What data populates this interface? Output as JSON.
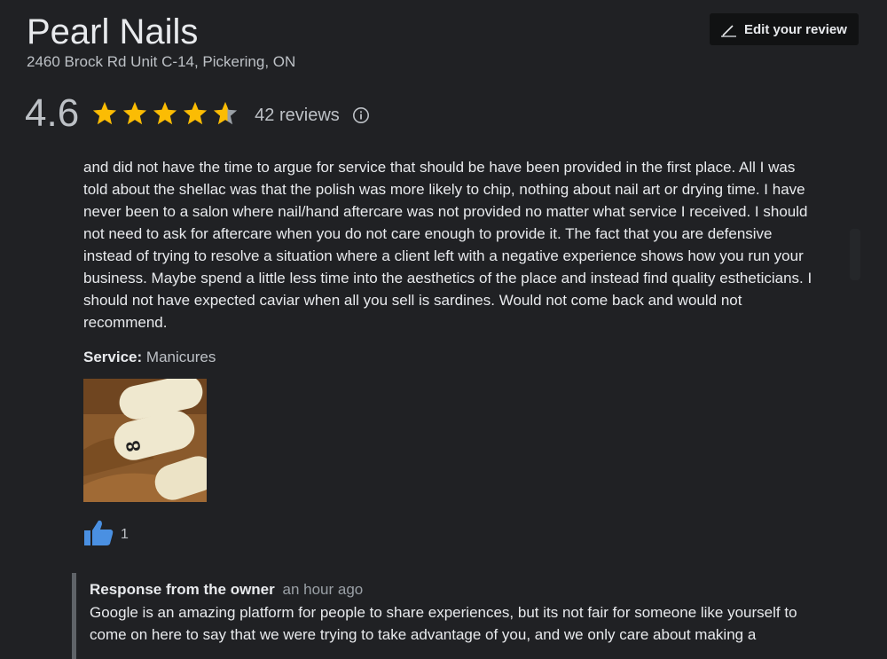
{
  "business": {
    "name": "Pearl Nails",
    "address": "2460 Brock Rd Unit C-14, Pickering, ON"
  },
  "header": {
    "edit_review_label": "Edit your review",
    "edit_icon": "pencil-icon"
  },
  "rating": {
    "value": "4.6",
    "stars_filled": 4.6,
    "stars_total": 5,
    "review_count": "42 reviews",
    "star_color": "#fbbc04",
    "star_empty_color": "#9aa0a6",
    "info_icon": "info-icon"
  },
  "review": {
    "text": "and did not have the time to argue for service that should be have been provided in the first place. All I was told about the shellac was that the polish was more likely to chip, nothing about nail art or drying time. I have never been to a salon where nail/hand aftercare was not provided no matter what service I received. I should not need to ask for aftercare when you do not care enough to provide it. The fact that you are defensive instead of trying to resolve a situation where a client left with a negative experience shows how you run your business. Maybe spend a little less time into the aesthetics of the place and instead find quality estheticians. I should not have expected caviar when all you sell is sardines. Would not come back and would not recommend.",
    "service_label": "Service:",
    "service_value": "Manicures",
    "photo_icon": "nail-photo",
    "like_icon": "thumbs-up-icon",
    "like_color": "#4a90e2",
    "like_count": "1"
  },
  "owner_response": {
    "title": "Response from the owner",
    "time": "an hour ago",
    "text": "Google is an amazing platform for people to share experiences, but its not fair for someone like yourself to come on here to say that we were trying to take advantage of you, and we only care about making a"
  }
}
